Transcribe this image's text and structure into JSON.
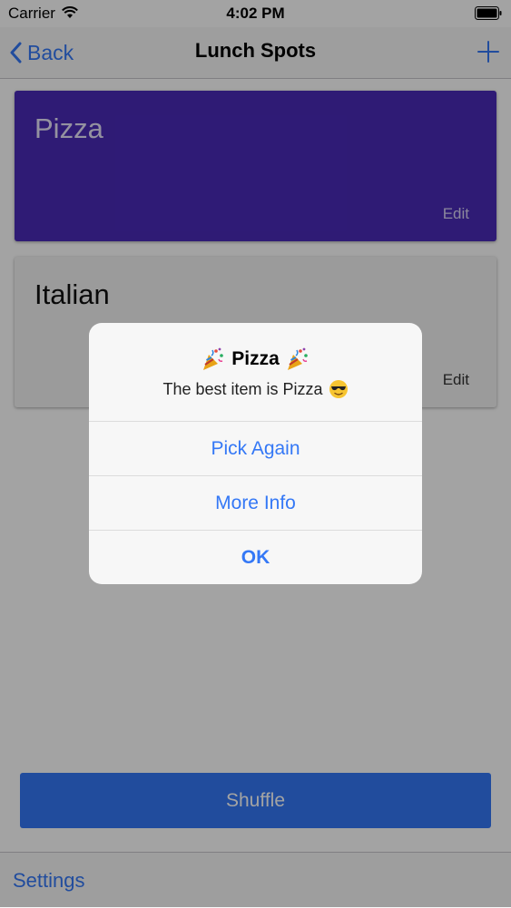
{
  "status_bar": {
    "carrier": "Carrier",
    "time": "4:02 PM"
  },
  "nav": {
    "back_label": "Back",
    "title": "Lunch Spots",
    "add_icon": "plus-icon"
  },
  "cards": [
    {
      "title": "Pizza",
      "edit_label": "Edit",
      "color": "#4a2bb8"
    },
    {
      "title": "Italian",
      "edit_label": "Edit",
      "color": "#f3f3f3"
    }
  ],
  "shuffle_label": "Shuffle",
  "settings_label": "Settings",
  "alert": {
    "title": "Pizza",
    "title_icon": "party-popper-icon",
    "message": "The best item is Pizza",
    "message_icon": "sunglasses-face-icon",
    "actions": [
      "Pick Again",
      "More Info",
      "OK"
    ]
  },
  "colors": {
    "accent": "#3478f6",
    "overlay": "rgba(0,0,0,0.36)"
  }
}
